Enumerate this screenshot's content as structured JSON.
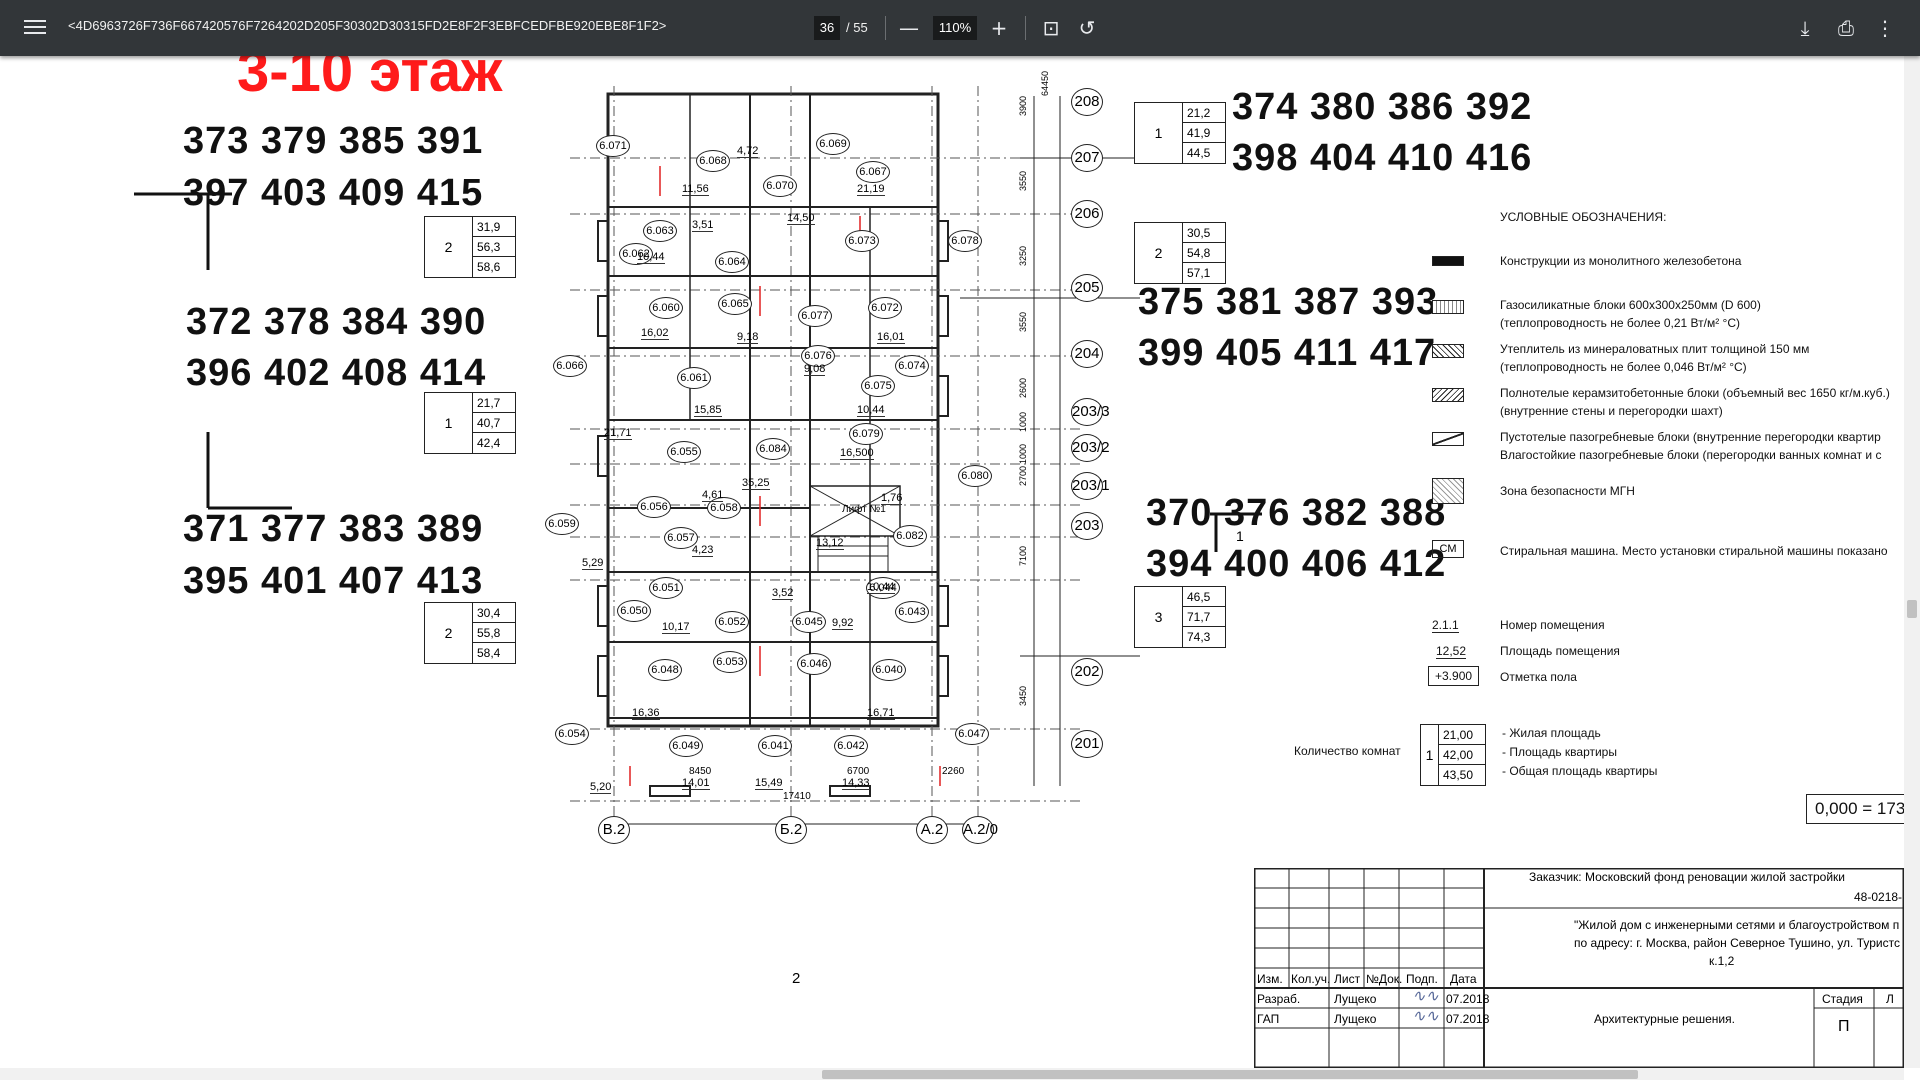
{
  "toolbar": {
    "title": "<4D6963726F736F667420576F7264202D205F30302D30315FD2E8F2F3EBFCEDFBE920EBE8F1F2>",
    "page_current": "36",
    "page_total": "/ 55",
    "zoom": "110%",
    "zoom_out_glyph": "—",
    "zoom_in_glyph": "+",
    "fit_glyph": "⊡",
    "rotate_glyph": "↺",
    "download_glyph": "⤓",
    "print_glyph": "⎙",
    "more_glyph": "⋮"
  },
  "floor_label": "3-10 этаж",
  "apartment_numbers": {
    "g1a": "373 379 385 391",
    "g1b": "397 403 409 415",
    "g2a": "372 378 384 390",
    "g2b": "396 402 408 414",
    "g3a": "371 377 383 389",
    "g3b": "395 401 407 413",
    "g4a": "374 380 386 392",
    "g4b": "398 404 410 416",
    "g5a": "375 381 387 393",
    "g5b": "399 405 411 417",
    "g6a": "370 376 382 388",
    "g6b": "394 400 406 412"
  },
  "area_boxes": [
    {
      "rooms": "2",
      "v1": "31,9",
      "v2": "56,3",
      "v3": "58,6"
    },
    {
      "rooms": "1",
      "v1": "21,7",
      "v2": "40,7",
      "v3": "42,4"
    },
    {
      "rooms": "2",
      "v1": "30,4",
      "v2": "55,8",
      "v3": "58,4"
    },
    {
      "rooms": "1",
      "v1": "21,2",
      "v2": "41,9",
      "v3": "44,5"
    },
    {
      "rooms": "2",
      "v1": "30,5",
      "v2": "54,8",
      "v3": "57,1"
    },
    {
      "rooms": "3",
      "v1": "46,5",
      "v2": "71,7",
      "v3": "74,3"
    }
  ],
  "plan": {
    "axes_right": [
      "208",
      "207",
      "206",
      "205",
      "204",
      "203/3",
      "203/2",
      "203/1",
      "203",
      "202",
      "201"
    ],
    "axes_bottom": [
      "В.2",
      "Б.2",
      "А.2",
      "А.2/0"
    ],
    "dims_bottom": [
      "8450",
      "6700",
      "2260",
      "17410"
    ],
    "dims_vertical": [
      "64450",
      "3900",
      "3550",
      "3250",
      "3550",
      "2600",
      "1000",
      "1000",
      "2700",
      "7100",
      "3450"
    ],
    "rooms": [
      {
        "id": "6.071"
      },
      {
        "id": "6.068"
      },
      {
        "id": "6.069"
      },
      {
        "id": "6.067"
      },
      {
        "id": "6.070"
      },
      {
        "id": "6.063"
      },
      {
        "id": "6.062"
      },
      {
        "id": "6.064"
      },
      {
        "id": "6.073"
      },
      {
        "id": "6.078"
      },
      {
        "id": "6.060"
      },
      {
        "id": "6.065"
      },
      {
        "id": "6.077"
      },
      {
        "id": "6.072"
      },
      {
        "id": "6.066"
      },
      {
        "id": "6.061"
      },
      {
        "id": "6.076"
      },
      {
        "id": "6.075"
      },
      {
        "id": "6.074"
      },
      {
        "id": "6.055"
      },
      {
        "id": "6.084"
      },
      {
        "id": "6.079"
      },
      {
        "id": "6.080"
      },
      {
        "id": "6.059"
      },
      {
        "id": "6.056"
      },
      {
        "id": "6.058"
      },
      {
        "id": "6.057"
      },
      {
        "id": "6.082"
      },
      {
        "id": "6.050"
      },
      {
        "id": "6.051"
      },
      {
        "id": "6.052"
      },
      {
        "id": "6.045"
      },
      {
        "id": "6.044"
      },
      {
        "id": "6.043"
      },
      {
        "id": "6.048"
      },
      {
        "id": "6.053"
      },
      {
        "id": "6.046"
      },
      {
        "id": "6.040"
      },
      {
        "id": "6.054"
      },
      {
        "id": "6.049"
      },
      {
        "id": "6.041"
      },
      {
        "id": "6.042"
      },
      {
        "id": "6.047"
      }
    ],
    "areas": [
      "11,56",
      "21,19",
      "14,50",
      "10,44",
      "16,02",
      "16,01",
      "15,85",
      "10,44",
      "21,71",
      "16,500",
      "35,25",
      "10,44",
      "10,17",
      "9,92",
      "16,36",
      "16,71",
      "14,01",
      "15,49",
      "14,33",
      "9,18",
      "9,08",
      "4,72",
      "3,51",
      "4,23",
      "3,52",
      "1,76",
      "13,12",
      "5,29",
      "5,20",
      "4,61"
    ],
    "section_mark": "2",
    "lift_label": "Лифт №1"
  },
  "legend": {
    "header": "УСЛОВНЫЕ ОБОЗНАЧЕНИЯ:",
    "items": [
      "Конструкции из монолитного железобетона",
      "Газосиликатные блоки 600х300х250мм (D 600)",
      "(теплопроводность не более 0,21 Вт/м² °С)",
      "Утеплитель из минераловатных плит толщиной 150 мм",
      "(теплопроводность не более 0,046 Вт/м² °С)",
      "Полнотелые керамзитобетонные блоки (объемный вес 1650 кг/м.куб.)",
      "(внутренние стены и перегородки шахт)",
      "Пустотелые пазогребневые блоки (внутренние перегородки квартир",
      "Влагостойкие пазогребневые блоки  (перегородки ванных комнат и с",
      "Зона безопасности МГН",
      "Стиральная машина. Место установки стиральной машины показано"
    ],
    "sm_label": "СМ",
    "room_num_sample": "2.1.1",
    "room_num_label": "Номер помещения",
    "room_area_sample": "12,52",
    "room_area_label": "Площадь помещения",
    "floor_mark_sample": "+3.900",
    "floor_mark_label": "Отметка пола",
    "rooms_count_label": "Количество комнат",
    "sample_rooms": "1",
    "sample_v1": "21,00",
    "sample_v2": "42,00",
    "sample_v3": "43,50",
    "sample_l1": "- Жилая площадь",
    "sample_l2": "- Площадь квартиры",
    "sample_l3": "- Общая площадь квартиры",
    "zero_mark": "0,000 = 173"
  },
  "title_block": {
    "customer": "Заказчик:  Московский фонд реновации жилой застройки",
    "code": "48-0218-",
    "project1": "\"Жилой дом с инженерными сетями и благоустройством п",
    "project2": "по адресу: г. Москва, район Северное Тушино, ул. Туристс",
    "project3": "к.1,2",
    "cols": [
      "Изм.",
      "Кол.уч.",
      "Лист",
      "№Док.",
      "Подп.",
      "Дата"
    ],
    "row1": [
      "Разраб.",
      "Лущеко",
      "07.2018"
    ],
    "row2": [
      "ГАП",
      "Лущеко",
      "07.2018"
    ],
    "section": "Архитектурные решения.",
    "stage_label": "Стадия",
    "stage": "П",
    "sheet_short": "Л"
  }
}
